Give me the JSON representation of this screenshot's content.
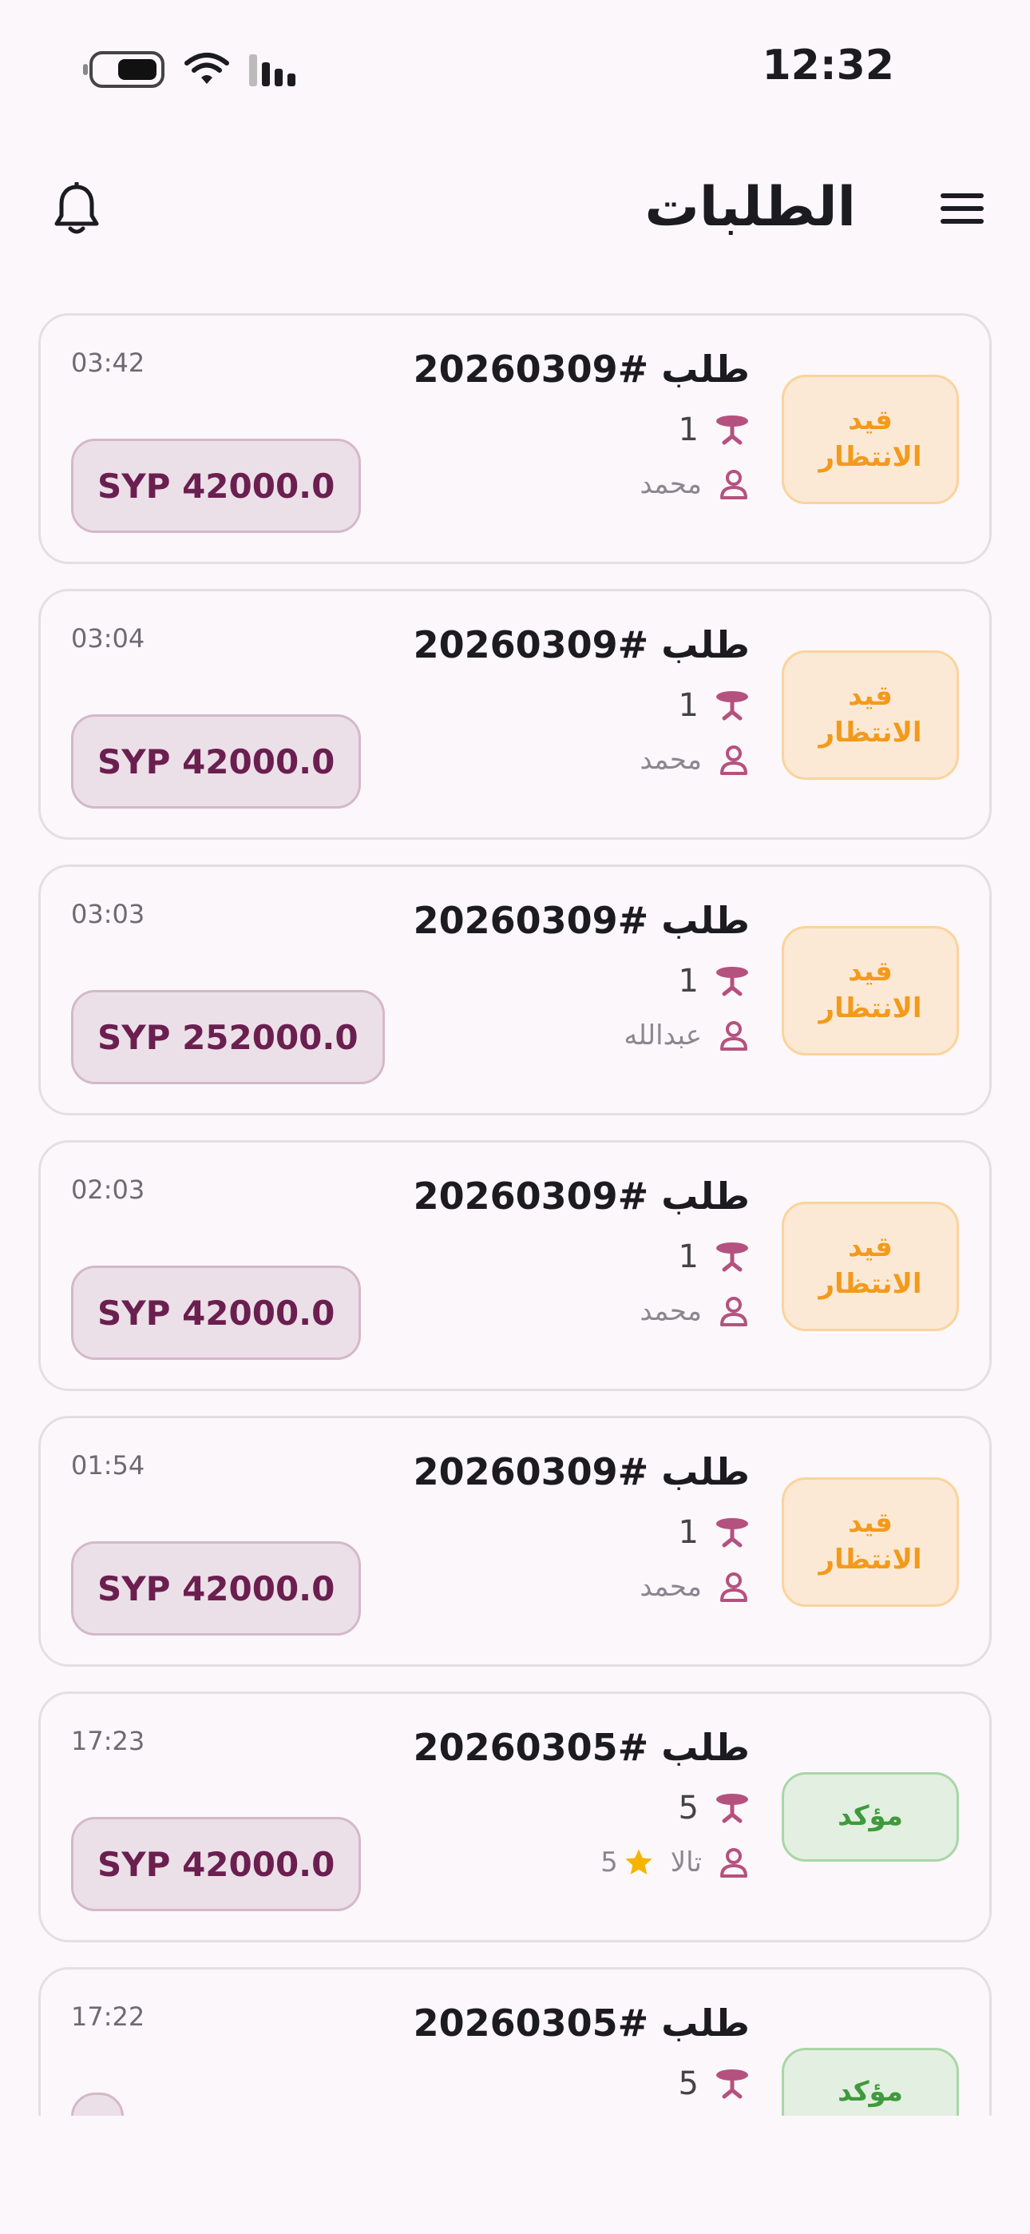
{
  "status_bar": {
    "time": "12:32"
  },
  "app_bar": {
    "title": "الطلبات"
  },
  "orders": [
    {
      "title": "طلب #20260309",
      "table": "1",
      "customer": "محمد",
      "rating": "",
      "time": "03:42",
      "price": "SYP 42000.0",
      "status": "قيد الانتظار",
      "status_type": "pending"
    },
    {
      "title": "طلب #20260309",
      "table": "1",
      "customer": "محمد",
      "rating": "",
      "time": "03:04",
      "price": "SYP 42000.0",
      "status": "قيد الانتظار",
      "status_type": "pending"
    },
    {
      "title": "طلب #20260309",
      "table": "1",
      "customer": "عبدالله",
      "rating": "",
      "time": "03:03",
      "price": "SYP 252000.0",
      "status": "قيد الانتظار",
      "status_type": "pending"
    },
    {
      "title": "طلب #20260309",
      "table": "1",
      "customer": "محمد",
      "rating": "",
      "time": "02:03",
      "price": "SYP 42000.0",
      "status": "قيد الانتظار",
      "status_type": "pending"
    },
    {
      "title": "طلب #20260309",
      "table": "1",
      "customer": "محمد",
      "rating": "",
      "time": "01:54",
      "price": "SYP 42000.0",
      "status": "قيد الانتظار",
      "status_type": "pending"
    },
    {
      "title": "طلب #20260305",
      "table": "5",
      "customer": "تالا",
      "rating": "5",
      "time": "17:23",
      "price": "SYP 42000.0",
      "status": "مؤكد",
      "status_type": "confirmed"
    },
    {
      "title": "طلب #20260305",
      "table": "5",
      "customer": "",
      "rating": "",
      "time": "17:22",
      "price": "",
      "status": "مؤكد",
      "status_type": "confirmed"
    }
  ],
  "colors": {
    "background": "#fcf7fb",
    "accent": "#6b1f50",
    "icon_accent": "#b5517f",
    "pending": "#f39a1c",
    "confirmed": "#3f9a3c",
    "star": "#f5b400"
  },
  "icons": {
    "menu": "menu-icon",
    "notifications": "bell-icon",
    "table": "table-icon",
    "customer": "person-icon",
    "rating": "star-icon"
  }
}
